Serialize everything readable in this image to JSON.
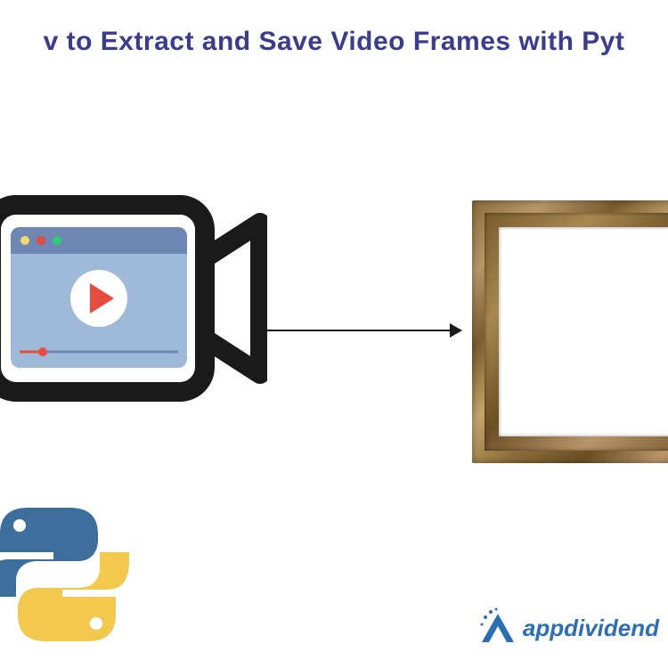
{
  "title": "v to Extract and Save Video Frames with Pyt",
  "brand": {
    "name": "appdividend"
  },
  "icons": {
    "camera": "video-camera-icon",
    "python": "python-logo-icon",
    "frame": "picture-frame-icon",
    "arrow": "arrow-right-icon",
    "brand_mark": "appdividend-logo-icon"
  },
  "colors": {
    "title": "#3b3b8f",
    "brand": "#2a6fb5",
    "python_blue": "#4b8bbe",
    "python_yellow": "#ffd43b"
  }
}
